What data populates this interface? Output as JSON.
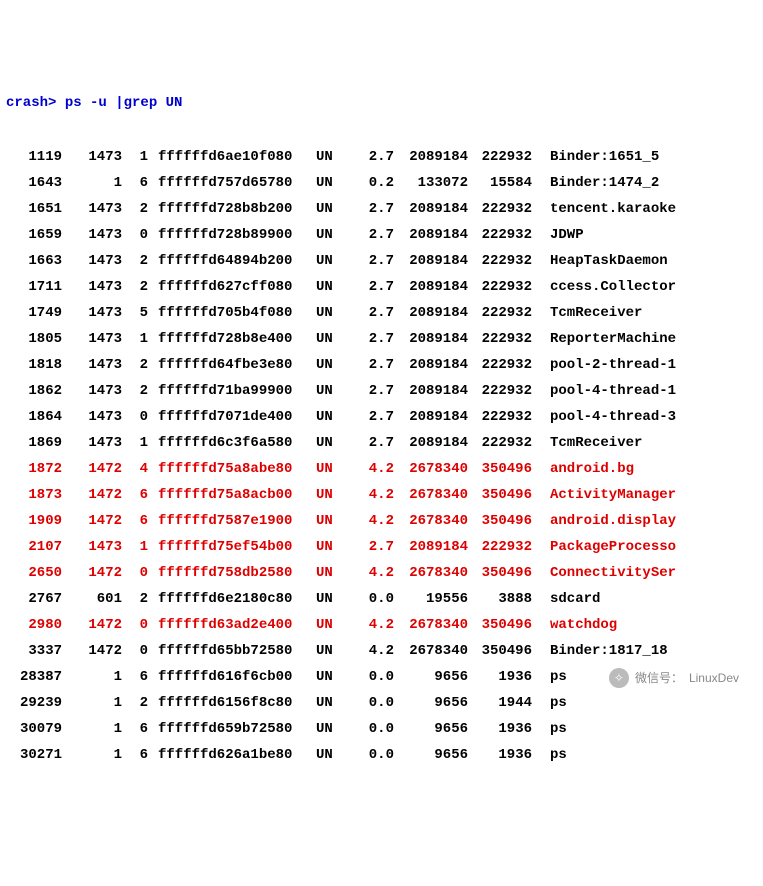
{
  "prompt": "crash>",
  "command": " ps -u |grep UN",
  "watermark": {
    "label": "微信号：",
    "value": "LinuxDev"
  },
  "rows": [
    {
      "pid": "1119",
      "ppid": "1473",
      "cpu": "1",
      "addr": "ffffffd6ae10f080",
      "st": "UN",
      "pct": "2.7",
      "vsz": "2089184",
      "rss": "222932",
      "cmd": "Binder:1651_5",
      "hl": false
    },
    {
      "pid": "1643",
      "ppid": "1",
      "cpu": "6",
      "addr": "ffffffd757d65780",
      "st": "UN",
      "pct": "0.2",
      "vsz": "133072",
      "rss": "15584",
      "cmd": "Binder:1474_2",
      "hl": false
    },
    {
      "pid": "1651",
      "ppid": "1473",
      "cpu": "2",
      "addr": "ffffffd728b8b200",
      "st": "UN",
      "pct": "2.7",
      "vsz": "2089184",
      "rss": "222932",
      "cmd": "tencent.karaoke",
      "hl": false
    },
    {
      "pid": "1659",
      "ppid": "1473",
      "cpu": "0",
      "addr": "ffffffd728b89900",
      "st": "UN",
      "pct": "2.7",
      "vsz": "2089184",
      "rss": "222932",
      "cmd": "JDWP",
      "hl": false
    },
    {
      "pid": "1663",
      "ppid": "1473",
      "cpu": "2",
      "addr": "ffffffd64894b200",
      "st": "UN",
      "pct": "2.7",
      "vsz": "2089184",
      "rss": "222932",
      "cmd": "HeapTaskDaemon",
      "hl": false
    },
    {
      "pid": "1711",
      "ppid": "1473",
      "cpu": "2",
      "addr": "ffffffd627cff080",
      "st": "UN",
      "pct": "2.7",
      "vsz": "2089184",
      "rss": "222932",
      "cmd": "ccess.Collector",
      "hl": false
    },
    {
      "pid": "1749",
      "ppid": "1473",
      "cpu": "5",
      "addr": "ffffffd705b4f080",
      "st": "UN",
      "pct": "2.7",
      "vsz": "2089184",
      "rss": "222932",
      "cmd": "TcmReceiver",
      "hl": false
    },
    {
      "pid": "1805",
      "ppid": "1473",
      "cpu": "1",
      "addr": "ffffffd728b8e400",
      "st": "UN",
      "pct": "2.7",
      "vsz": "2089184",
      "rss": "222932",
      "cmd": "ReporterMachine",
      "hl": false
    },
    {
      "pid": "1818",
      "ppid": "1473",
      "cpu": "2",
      "addr": "ffffffd64fbe3e80",
      "st": "UN",
      "pct": "2.7",
      "vsz": "2089184",
      "rss": "222932",
      "cmd": "pool-2-thread-1",
      "hl": false
    },
    {
      "pid": "1862",
      "ppid": "1473",
      "cpu": "2",
      "addr": "ffffffd71ba99900",
      "st": "UN",
      "pct": "2.7",
      "vsz": "2089184",
      "rss": "222932",
      "cmd": "pool-4-thread-1",
      "hl": false
    },
    {
      "pid": "1864",
      "ppid": "1473",
      "cpu": "0",
      "addr": "ffffffd7071de400",
      "st": "UN",
      "pct": "2.7",
      "vsz": "2089184",
      "rss": "222932",
      "cmd": "pool-4-thread-3",
      "hl": false
    },
    {
      "pid": "1869",
      "ppid": "1473",
      "cpu": "1",
      "addr": "ffffffd6c3f6a580",
      "st": "UN",
      "pct": "2.7",
      "vsz": "2089184",
      "rss": "222932",
      "cmd": "TcmReceiver",
      "hl": false
    },
    {
      "pid": "1872",
      "ppid": "1472",
      "cpu": "4",
      "addr": "ffffffd75a8abe80",
      "st": "UN",
      "pct": "4.2",
      "vsz": "2678340",
      "rss": "350496",
      "cmd": "android.bg",
      "hl": true
    },
    {
      "pid": "1873",
      "ppid": "1472",
      "cpu": "6",
      "addr": "ffffffd75a8acb00",
      "st": "UN",
      "pct": "4.2",
      "vsz": "2678340",
      "rss": "350496",
      "cmd": "ActivityManager",
      "hl": true
    },
    {
      "pid": "1909",
      "ppid": "1472",
      "cpu": "6",
      "addr": "ffffffd7587e1900",
      "st": "UN",
      "pct": "4.2",
      "vsz": "2678340",
      "rss": "350496",
      "cmd": "android.display",
      "hl": true
    },
    {
      "pid": "2107",
      "ppid": "1473",
      "cpu": "1",
      "addr": "ffffffd75ef54b00",
      "st": "UN",
      "pct": "2.7",
      "vsz": "2089184",
      "rss": "222932",
      "cmd": "PackageProcesso",
      "hl": true
    },
    {
      "pid": "2650",
      "ppid": "1472",
      "cpu": "0",
      "addr": "ffffffd758db2580",
      "st": "UN",
      "pct": "4.2",
      "vsz": "2678340",
      "rss": "350496",
      "cmd": "ConnectivitySer",
      "hl": true
    },
    {
      "pid": "2767",
      "ppid": "601",
      "cpu": "2",
      "addr": "ffffffd6e2180c80",
      "st": "UN",
      "pct": "0.0",
      "vsz": "19556",
      "rss": "3888",
      "cmd": "sdcard",
      "hl": false
    },
    {
      "pid": "2980",
      "ppid": "1472",
      "cpu": "0",
      "addr": "ffffffd63ad2e400",
      "st": "UN",
      "pct": "4.2",
      "vsz": "2678340",
      "rss": "350496",
      "cmd": "watchdog",
      "hl": true
    },
    {
      "pid": "3337",
      "ppid": "1472",
      "cpu": "0",
      "addr": "ffffffd65bb72580",
      "st": "UN",
      "pct": "4.2",
      "vsz": "2678340",
      "rss": "350496",
      "cmd": "Binder:1817_18",
      "hl": false
    },
    {
      "pid": "28387",
      "ppid": "1",
      "cpu": "6",
      "addr": "ffffffd616f6cb00",
      "st": "UN",
      "pct": "0.0",
      "vsz": "9656",
      "rss": "1936",
      "cmd": "ps",
      "hl": false
    },
    {
      "pid": "29239",
      "ppid": "1",
      "cpu": "2",
      "addr": "ffffffd6156f8c80",
      "st": "UN",
      "pct": "0.0",
      "vsz": "9656",
      "rss": "1944",
      "cmd": "ps",
      "hl": false
    },
    {
      "pid": "30079",
      "ppid": "1",
      "cpu": "6",
      "addr": "ffffffd659b72580",
      "st": "UN",
      "pct": "0.0",
      "vsz": "9656",
      "rss": "1936",
      "cmd": "ps",
      "hl": false
    },
    {
      "pid": "30271",
      "ppid": "1",
      "cpu": "6",
      "addr": "ffffffd626a1be80",
      "st": "UN",
      "pct": "0.0",
      "vsz": "9656",
      "rss": "1936",
      "cmd": "ps",
      "hl": false
    }
  ]
}
